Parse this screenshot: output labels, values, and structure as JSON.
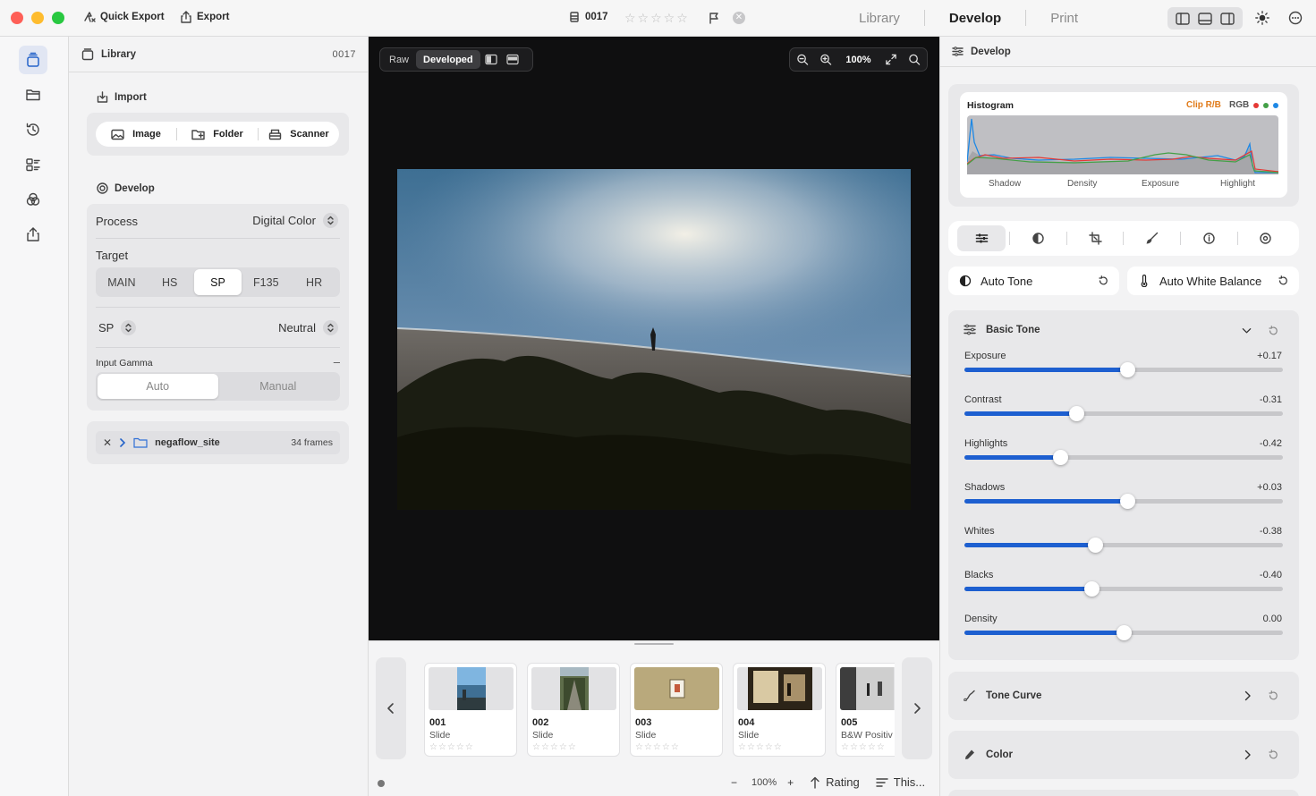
{
  "titlebar": {
    "quick_export": "Quick Export",
    "export": "Export",
    "frame_number": "0017",
    "rating_stars": "☆☆☆☆☆",
    "modes": [
      "Library",
      "Develop",
      "Print"
    ],
    "active_mode": "Develop"
  },
  "library": {
    "title": "Library",
    "frame_number": "0017",
    "import_title": "Import",
    "import_buttons": [
      "Image",
      "Folder",
      "Scanner"
    ],
    "develop_title": "Develop",
    "process_label": "Process",
    "process_value": "Digital Color",
    "target_label": "Target",
    "target_options": [
      "MAIN",
      "HS",
      "SP",
      "F135",
      "HR"
    ],
    "target_selected": "SP",
    "sp_label": "SP",
    "neutral_label": "Neutral",
    "gamma_label": "Input Gamma",
    "gamma_collapse": "–",
    "gamma_options": [
      "Auto",
      "Manual"
    ],
    "gamma_selected": "Auto",
    "folder_name": "negaflow_site",
    "folder_count": "34 frames"
  },
  "viewer": {
    "view_options": [
      "Raw",
      "Developed"
    ],
    "view_selected": "Developed",
    "zoom": "100%"
  },
  "filmstrip": {
    "frames": [
      {
        "num": "001",
        "type": "Slide",
        "stars": "☆☆☆☆☆"
      },
      {
        "num": "002",
        "type": "Slide",
        "stars": "☆☆☆☆☆"
      },
      {
        "num": "003",
        "type": "Slide",
        "stars": "☆☆☆☆☆"
      },
      {
        "num": "004",
        "type": "Slide",
        "stars": "☆☆☆☆☆"
      },
      {
        "num": "005",
        "type": "B&W Positiv",
        "stars": "☆☆☆☆☆"
      }
    ],
    "zoom_minus": "−",
    "zoom": "100%",
    "zoom_plus": "+",
    "rating_label": "Rating",
    "sort_label": "This..."
  },
  "develop": {
    "title": "Develop",
    "histogram": {
      "title": "Histogram",
      "clip_label": "Clip R/B",
      "rgb_label": "RGB",
      "channel_colors": [
        "#e53935",
        "#43a047",
        "#1e88e5"
      ],
      "axis_labels": [
        "Shadow",
        "Density",
        "Exposure",
        "Highlight"
      ]
    },
    "auto_tone": "Auto Tone",
    "auto_wb": "Auto White Balance",
    "basic_tone": {
      "title": "Basic Tone",
      "sliders": [
        {
          "label": "Exposure",
          "value": "+0.17",
          "fraction": 0.51
        },
        {
          "label": "Contrast",
          "value": "-0.31",
          "fraction": 0.35
        },
        {
          "label": "Highlights",
          "value": "-0.42",
          "fraction": 0.3
        },
        {
          "label": "Shadows",
          "value": "+0.03",
          "fraction": 0.51
        },
        {
          "label": "Whites",
          "value": "-0.38",
          "fraction": 0.41
        },
        {
          "label": "Blacks",
          "value": "-0.40",
          "fraction": 0.4
        },
        {
          "label": "Density",
          "value": "0.00",
          "fraction": 0.5
        }
      ]
    },
    "tone_curve": "Tone Curve",
    "color": "Color",
    "accent_color": "#1d5fd0"
  }
}
